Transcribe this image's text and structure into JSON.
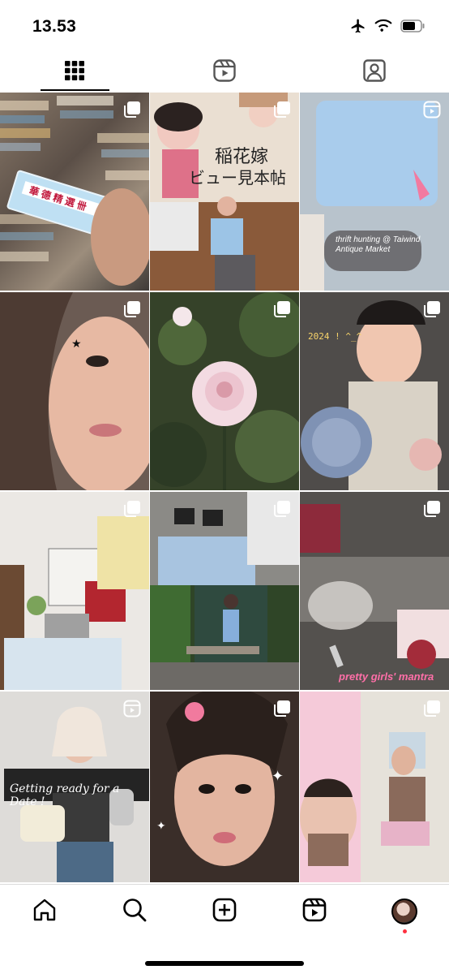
{
  "status_bar": {
    "time": "13.53"
  },
  "tabs": [
    {
      "name": "grid-icon",
      "active": true
    },
    {
      "name": "reels-icon",
      "active": false
    },
    {
      "name": "tagged-icon",
      "active": false
    }
  ],
  "posts": [
    {
      "corner": "carousel-icon",
      "caption": ""
    },
    {
      "corner": "carousel-icon",
      "caption": ""
    },
    {
      "corner": "reel-icon",
      "caption": "thrift hunting @ Taiwind Antique Market"
    },
    {
      "corner": "carousel-icon",
      "caption": ""
    },
    {
      "corner": "carousel-icon",
      "caption": ""
    },
    {
      "corner": "carousel-icon",
      "caption": "2024 ! ^_^"
    },
    {
      "corner": "carousel-icon",
      "caption": ""
    },
    {
      "corner": "carousel-icon",
      "caption": ""
    },
    {
      "corner": "carousel-icon",
      "caption": "pretty girls' mantra"
    },
    {
      "corner": "reel-icon",
      "caption": "Getting ready for a Date !"
    },
    {
      "corner": "carousel-icon",
      "caption": ""
    },
    {
      "corner": "carousel-icon",
      "caption": ""
    }
  ],
  "bottom_nav": [
    {
      "name": "home-icon"
    },
    {
      "name": "search-icon"
    },
    {
      "name": "create-icon"
    },
    {
      "name": "reels-nav-icon"
    },
    {
      "name": "profile-avatar"
    }
  ],
  "colors": {
    "notification_dot": "#ff3040"
  }
}
